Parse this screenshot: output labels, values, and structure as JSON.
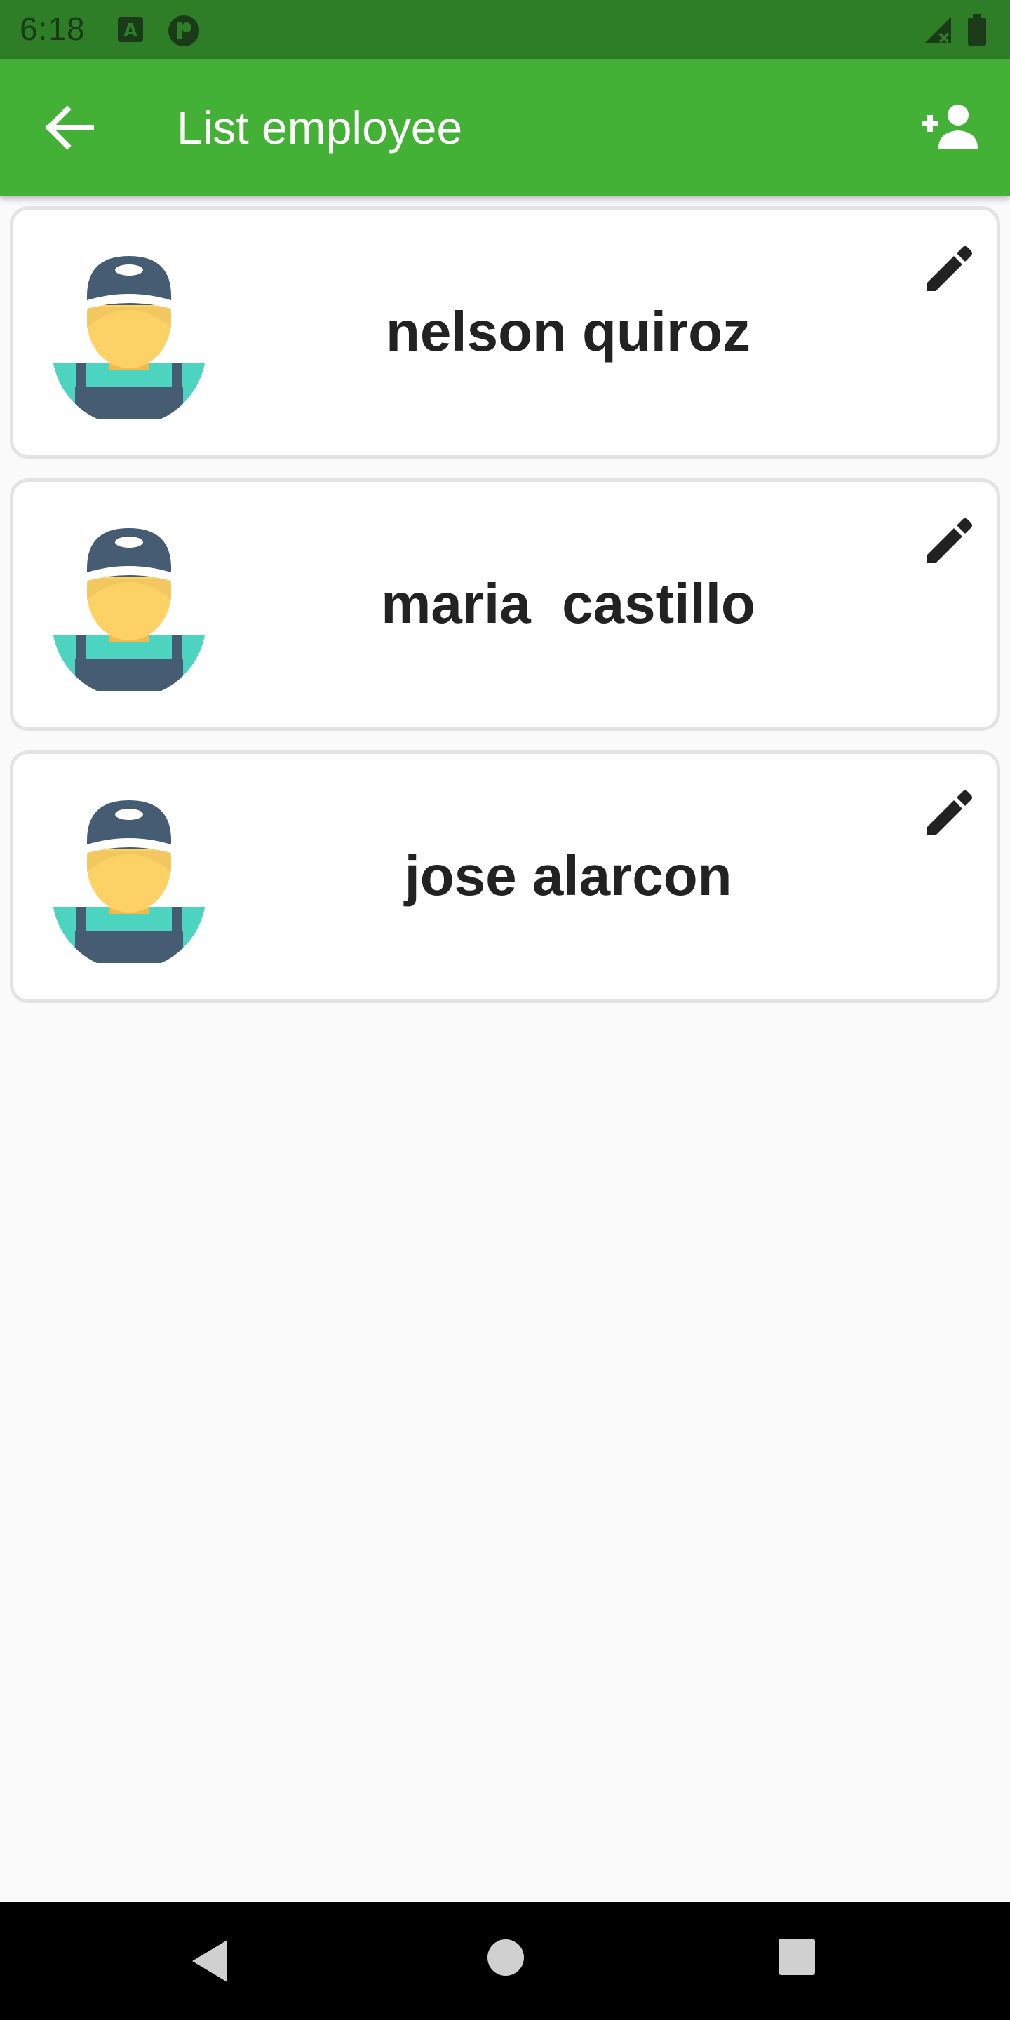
{
  "status_bar": {
    "time": "6:18",
    "icons": [
      "a-badge-icon",
      "circle-p-icon",
      "signal-icon",
      "battery-icon"
    ],
    "color": "#2e7d27"
  },
  "app_bar": {
    "title": "List employee",
    "back_icon": "arrow-back-icon",
    "action_icon": "person-add-icon",
    "color": "#43b135"
  },
  "employees": [
    {
      "name": "nelson quiroz"
    },
    {
      "name": "maria  castillo"
    },
    {
      "name": "jose alarcon"
    }
  ],
  "nav_bar": {
    "buttons": [
      "back-triangle-icon",
      "home-circle-icon",
      "recents-square-icon"
    ]
  }
}
